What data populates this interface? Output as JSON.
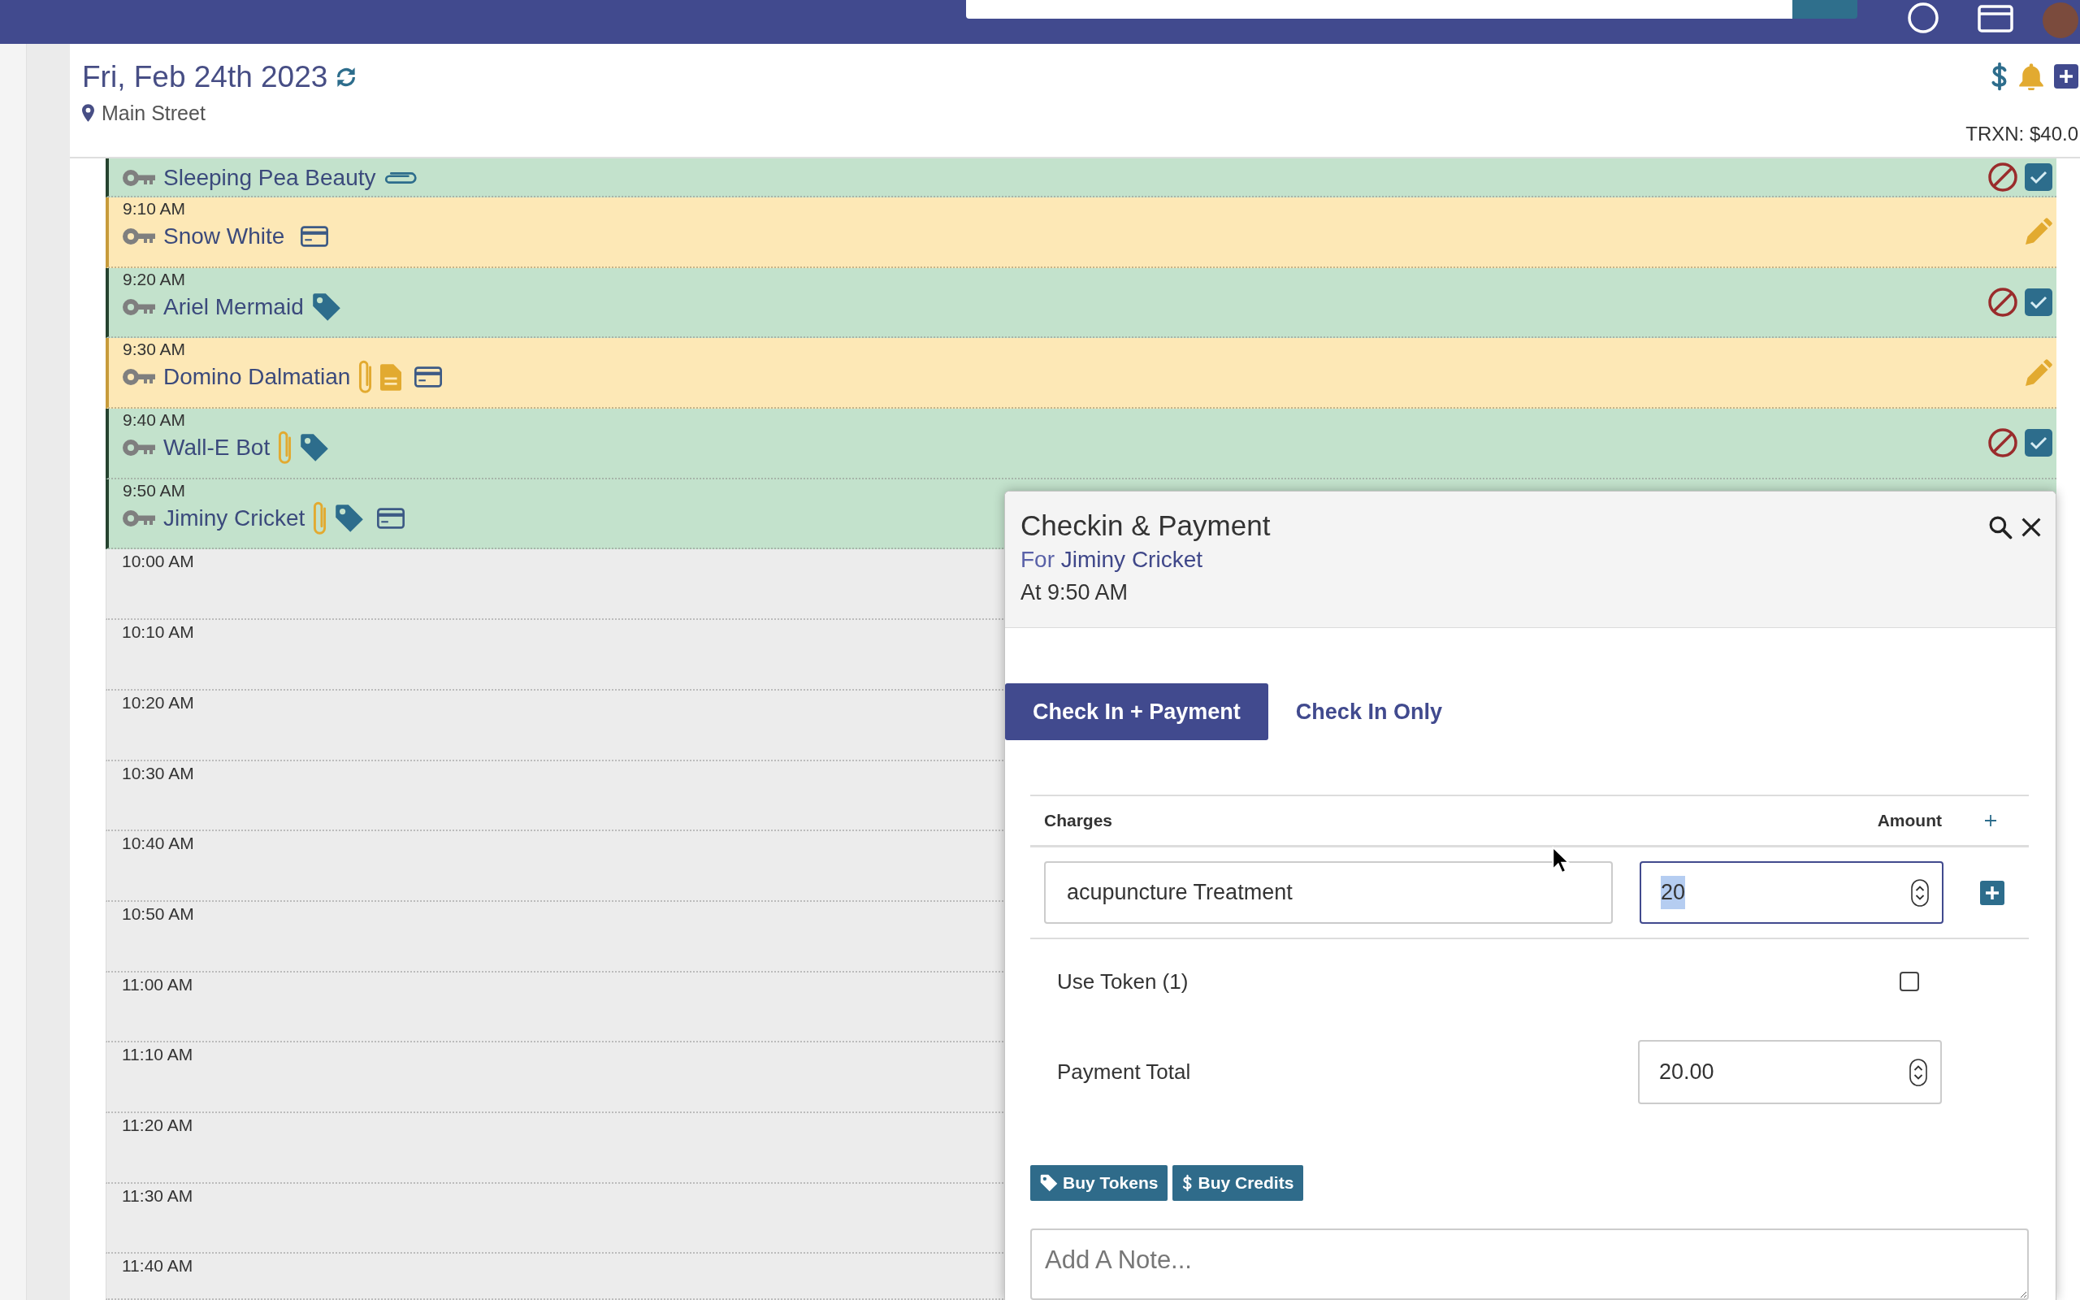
{
  "header": {
    "date": "Fri, Feb 24th 2023",
    "location": "Main Street",
    "transaction_total": "TRXN: $40.0"
  },
  "appointments": [
    {
      "name": "Sleeping Pea Beauty",
      "checked_in": true,
      "indicators": [
        {
          "kind": "link"
        }
      ],
      "actions": [
        {
          "kind": "cancel"
        },
        {
          "kind": "check"
        }
      ]
    },
    {
      "time": "9:10 AM",
      "name": "Snow White",
      "checked_in": false,
      "indicators": [
        {
          "kind": "card"
        }
      ],
      "actions": [
        {
          "kind": "edit"
        }
      ]
    },
    {
      "time": "9:20 AM",
      "name": "Ariel Mermaid",
      "checked_in": true,
      "indicators": [
        {
          "kind": "tag"
        }
      ],
      "actions": [
        {
          "kind": "cancel"
        },
        {
          "kind": "check"
        }
      ]
    },
    {
      "time": "9:30 AM",
      "name": "Domino Dalmatian",
      "checked_in": false,
      "indicators": [
        {
          "kind": "attachment"
        },
        {
          "kind": "document"
        },
        {
          "kind": "card"
        }
      ],
      "actions": [
        {
          "kind": "edit"
        }
      ]
    },
    {
      "time": "9:40 AM",
      "name": "Wall-E Bot",
      "checked_in": true,
      "indicators": [
        {
          "kind": "attachment"
        },
        {
          "kind": "tag"
        }
      ],
      "actions": [
        {
          "kind": "cancel"
        },
        {
          "kind": "check"
        }
      ]
    },
    {
      "time": "9:50 AM",
      "name": "Jiminy Cricket",
      "checked_in": true,
      "indicators": [
        {
          "kind": "attachment"
        },
        {
          "kind": "tag"
        },
        {
          "kind": "card"
        }
      ]
    }
  ],
  "open_slots": [
    "10:00 AM",
    "10:10 AM",
    "10:20 AM",
    "10:30 AM",
    "10:40 AM",
    "10:50 AM",
    "11:00 AM",
    "11:10 AM",
    "11:20 AM",
    "11:30 AM",
    "11:40 AM"
  ],
  "checkin_dialog": {
    "title": "Checkin & Payment",
    "for_prefix": "For",
    "client": "Jiminy Cricket",
    "time": "At 9:50 AM",
    "modes": [
      {
        "label": "Check In + Payment",
        "selected": true
      },
      {
        "label": "Check In Only",
        "selected": false
      }
    ],
    "charges": {
      "columns": [
        "Charges",
        "Amount"
      ],
      "rows": [
        {
          "description": "acupuncture Treatment",
          "amount": "20",
          "focused": true
        }
      ]
    },
    "use_token": {
      "label": "Use Token (1)",
      "checked": false
    },
    "payment_total": {
      "label": "Payment Total",
      "value": "20.00"
    },
    "buttons": [
      {
        "label": "Buy Tokens",
        "kind": "tag"
      },
      {
        "label": "Buy Credits",
        "kind": "dollar"
      }
    ],
    "note": {
      "placeholder": "Add A Note..."
    }
  }
}
